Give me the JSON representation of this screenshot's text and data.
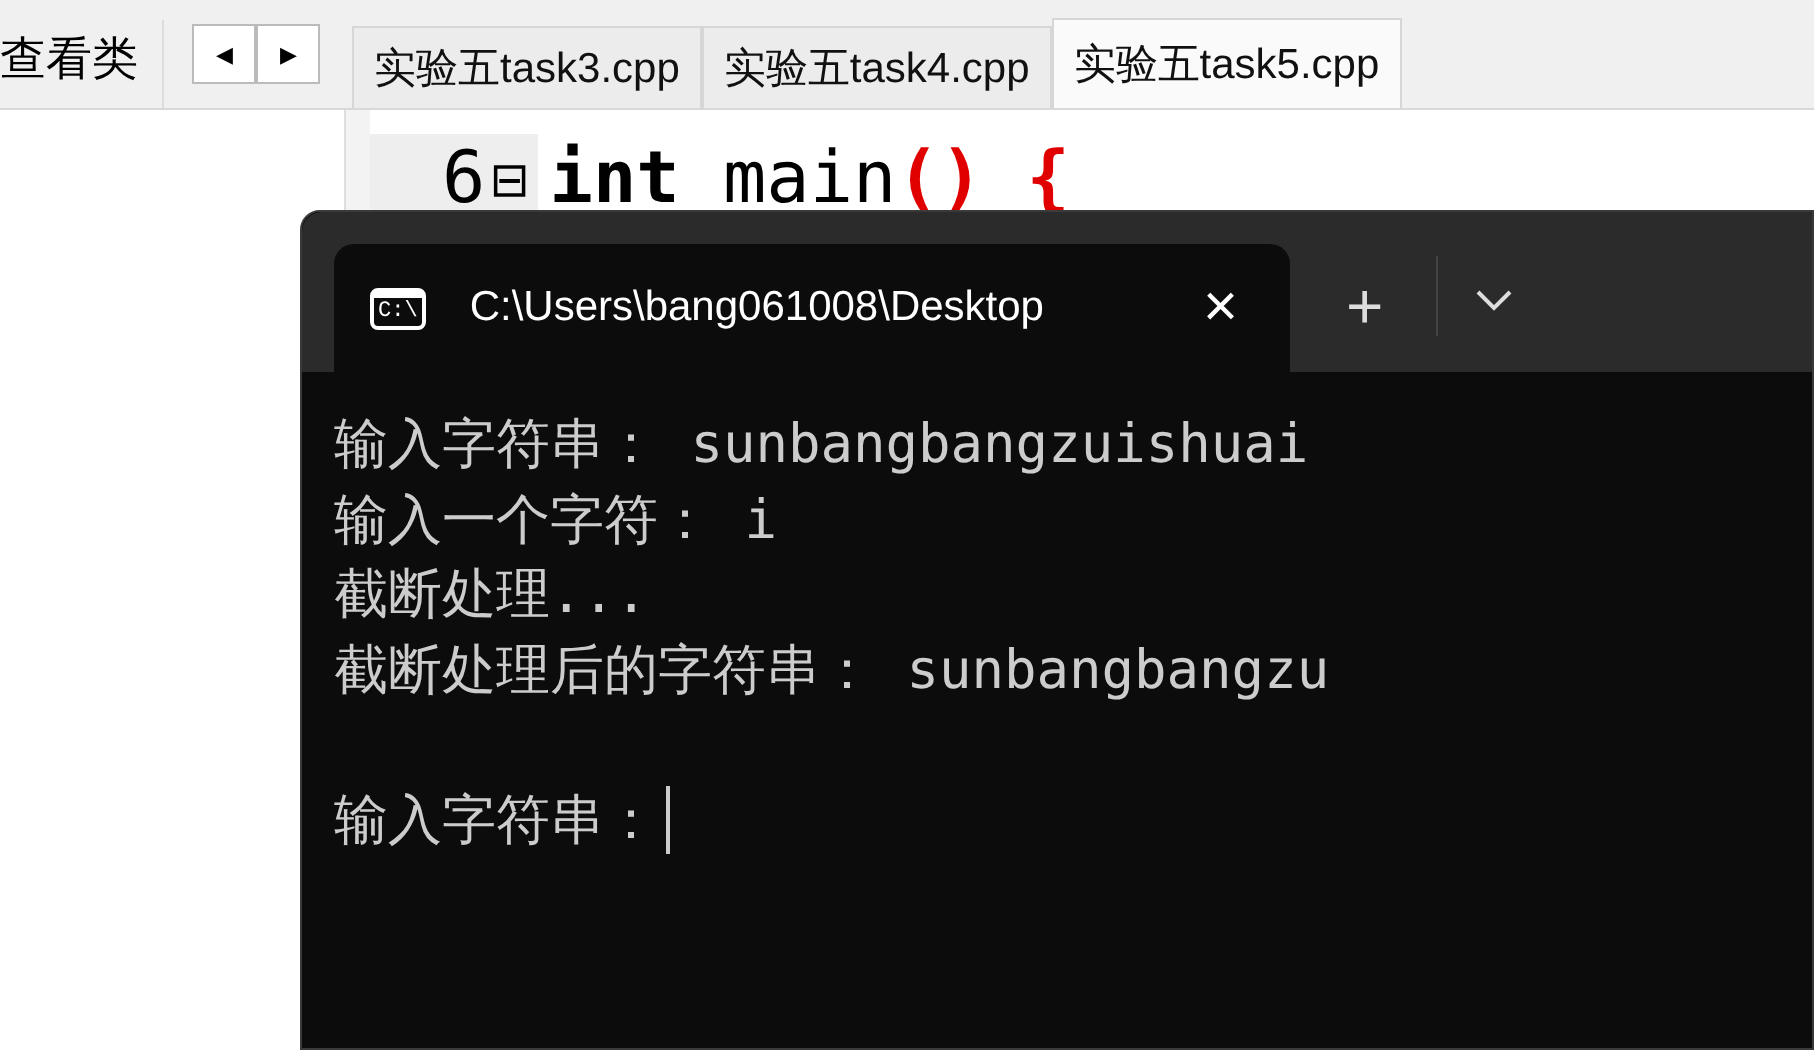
{
  "ide": {
    "side_tab": {
      "label": "查看类"
    },
    "nav_buttons": [
      {
        "glyph": "◀"
      },
      {
        "glyph": "▶"
      }
    ],
    "tabs": [
      {
        "label": "实验五task3.cpp",
        "selected": false
      },
      {
        "label": "实验五task4.cpp",
        "selected": false
      },
      {
        "label": "实验五task5.cpp",
        "selected": true
      }
    ],
    "editor": {
      "line_number": "6",
      "fold": "⊟",
      "tokens": [
        {
          "kind": "keyword",
          "text": "int"
        },
        {
          "kind": "plain",
          "text": " main"
        },
        {
          "kind": "punct",
          "text": "()"
        },
        {
          "kind": "punct",
          "text": " {"
        }
      ]
    }
  },
  "terminal": {
    "tab": {
      "icon_text": "C:\\",
      "title": "C:\\Users\\bang061008\\Desktop",
      "close": "×"
    },
    "new_tab": "+",
    "lines": [
      "输入字符串： sunbangbangzuishuai",
      "输入一个字符： i",
      "截断处理...",
      "截断处理后的字符串： sunbangbangzu"
    ],
    "prompt": {
      "text": "输入字符串：",
      "cursor": true
    }
  }
}
